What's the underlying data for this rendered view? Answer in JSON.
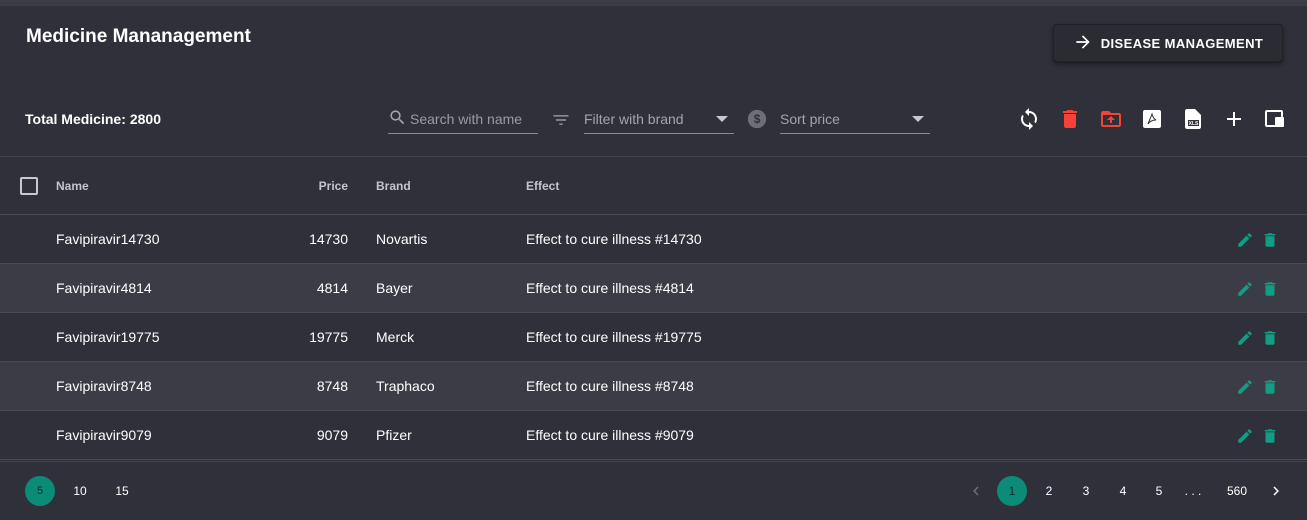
{
  "header": {
    "title": "Medicine Mananagement",
    "disease_button": "DISEASE MANAGEMENT"
  },
  "summary": {
    "label": "Total Medicine:",
    "count": "2800"
  },
  "filters": {
    "search_placeholder": "Search with name",
    "brand_placeholder": "Filter with brand",
    "sort_placeholder": "Sort price"
  },
  "toolbar": [
    "refresh-icon",
    "delete-icon",
    "upload-icon",
    "pdf-icon",
    "excel-icon",
    "add-icon",
    "columns-icon"
  ],
  "colors": {
    "accent": "#0b8c79",
    "danger": "#f44336",
    "action": "#129e84"
  },
  "table": {
    "columns": {
      "name": "Name",
      "price": "Price",
      "brand": "Brand",
      "effect": "Effect"
    },
    "rows": [
      {
        "name": "Favipiravir14730",
        "price": "14730",
        "brand": "Novartis",
        "effect": "Effect to cure illness #14730"
      },
      {
        "name": "Favipiravir4814",
        "price": "4814",
        "brand": "Bayer",
        "effect": "Effect to cure illness #4814"
      },
      {
        "name": "Favipiravir19775",
        "price": "19775",
        "brand": "Merck",
        "effect": "Effect to cure illness #19775"
      },
      {
        "name": "Favipiravir8748",
        "price": "8748",
        "brand": "Traphaco",
        "effect": "Effect to cure illness #8748"
      },
      {
        "name": "Favipiravir9079",
        "price": "9079",
        "brand": "Pfizer",
        "effect": "Effect to cure illness #9079"
      }
    ]
  },
  "page_sizes": [
    "5",
    "10",
    "15"
  ],
  "pagination": {
    "pages": [
      "1",
      "2",
      "3",
      "4",
      "5"
    ],
    "ellipsis": ". . .",
    "last": "560",
    "current": "1"
  }
}
